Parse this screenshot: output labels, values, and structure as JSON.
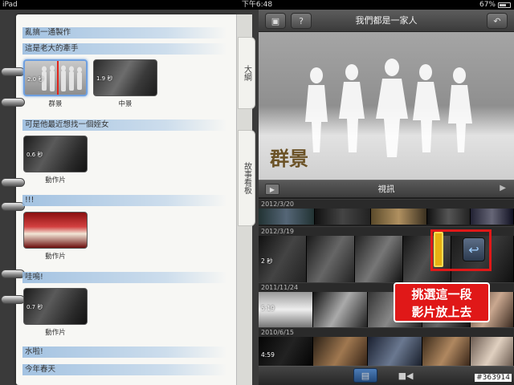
{
  "status": {
    "device": "iPad",
    "time": "下午6:48",
    "battery": "67%"
  },
  "storyboard": {
    "tabs": [
      "大綱",
      "故事看板"
    ],
    "notes": {
      "n1": "亂搞一通製作",
      "n2": "這是老大的牽手",
      "n3": "可是他最近想找一個姪女",
      "n4": "!!!",
      "n5": "哇嗚!",
      "n6": "水啦!",
      "n7": "今年春天"
    },
    "clips": [
      {
        "label": "群景",
        "duration": "2.0 秒"
      },
      {
        "label": "中景",
        "duration": "1.9 秒"
      },
      {
        "label": "動作片",
        "duration": "0.6 秒"
      },
      {
        "label": "動作片",
        "duration": ""
      },
      {
        "label": "動作片",
        "duration": "0.7 秒"
      }
    ]
  },
  "project": {
    "title": "我們都是一家人",
    "viewer_caption": "群景",
    "video_label": "視訊"
  },
  "browser": {
    "groups": [
      {
        "date": "2012/3/20",
        "duration": ""
      },
      {
        "date": "2012/3/19",
        "duration": "2 秒"
      },
      {
        "date": "2011/11/24",
        "duration": "5:19"
      },
      {
        "date": "2010/6/15",
        "duration": "4:59"
      }
    ]
  },
  "annotation": {
    "line1": "挑選這一段",
    "line2": "影片放上去"
  },
  "watermark": "#363914",
  "icons": {
    "top_left": "film-icon",
    "help": "question-icon",
    "top_right": "undo-icon",
    "play": "play-icon",
    "return": "return-arrow-icon",
    "filmstrip": "filmstrip-icon",
    "camera": "video-camera-icon"
  }
}
